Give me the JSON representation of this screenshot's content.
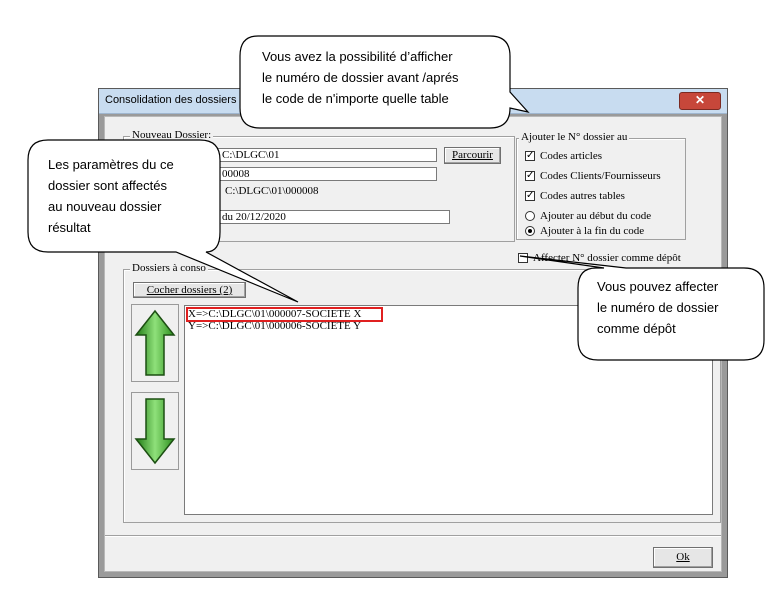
{
  "window": {
    "title": "Consolidation des dossiers",
    "close_icon": "close-icon"
  },
  "nouveau_dossier": {
    "label": "Nouveau Dossier:",
    "path_value": "C:\\DLGC\\01",
    "browse_button": "Parcourir",
    "number_value": "00008",
    "result_path": "C:\\DLGC\\01\\000008",
    "name_value": "du 20/12/2020"
  },
  "ajouter": {
    "label": "Ajouter le N° dossier au",
    "options": [
      {
        "label": "Codes articles",
        "checked": true
      },
      {
        "label": "Codes Clients/Fournisseurs",
        "checked": true
      },
      {
        "label": "Codes autres tables",
        "checked": true
      }
    ],
    "radios": [
      {
        "label": "Ajouter au début du code",
        "selected": false
      },
      {
        "label": "Ajouter à la fin du code",
        "selected": true
      }
    ]
  },
  "affecter_depot": {
    "label": "Affecter N° dossier comme dépôt",
    "checked": false
  },
  "dossiers": {
    "label": "Dossiers à conso",
    "cocher_button": "Cocher dossiers (2)",
    "rows": [
      "X=>C:\\DLGC\\01\\000007-SOCIETE X",
      "Y=>C:\\DLGC\\01\\000006-SOCIETE Y"
    ]
  },
  "ok_button": "Ok",
  "callouts": {
    "top": [
      "Vous avez la possibilité d’afficher",
      "le numéro de dossier avant  /aprés",
      "le code de n'importe quelle table"
    ],
    "left": [
      "Les paramètres du ce",
      "dossier sont affectés",
      "au nouveau dossier",
      "résultat"
    ],
    "right": [
      "Vous pouvez affecter",
      "le numéro de dossier",
      "comme dépôt"
    ]
  },
  "colors": {
    "selection_outline": "#e02020",
    "arrow_green": "#3fae2a",
    "titlebar": "#c8dcf0"
  }
}
